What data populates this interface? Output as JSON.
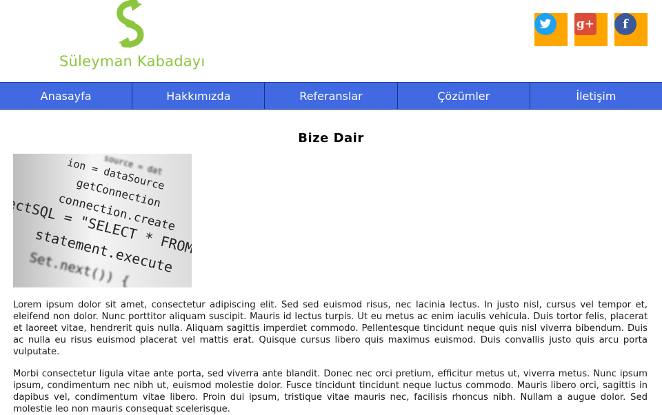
{
  "site": {
    "logo_text": "Süleyman Kabadayı",
    "logo_color": "#8cc63f"
  },
  "social": [
    {
      "name": "twitter",
      "icon": "twitter-icon",
      "color": "#1da1f2"
    },
    {
      "name": "googleplus",
      "icon": "google-plus-icon",
      "color": "#dd4b39"
    },
    {
      "name": "facebook",
      "icon": "facebook-icon",
      "color": "#3b5998"
    }
  ],
  "nav": {
    "items": [
      {
        "label": "Anasayfa"
      },
      {
        "label": "Hakkımızda"
      },
      {
        "label": "Referanslar"
      },
      {
        "label": "Çözümler"
      },
      {
        "label": "İletişim"
      }
    ],
    "bg_color": "#4169e1"
  },
  "main": {
    "title": "Bize Dair",
    "image_lines": [
      "source = dat",
      "ion = dataSource",
      "getConnection",
      "connection.create",
      "ectSQL = \"SELECT * FROM",
      "statement.execute",
      "Set.next()) {"
    ],
    "paragraphs": [
      "Lorem ipsum dolor sit amet, consectetur adipiscing elit. Sed sed euismod risus, nec lacinia lectus. In justo nisl, cursus vel tempor et, eleifend non dolor. Nunc porttitor aliquam suscipit. Mauris id lectus turpis. Ut eu metus ac enim iaculis vehicula. Duis tortor felis, placerat et laoreet vitae, hendrerit quis nulla. Aliquam sagittis imperdiet commodo. Pellentesque tincidunt neque quis nisl viverra bibendum. Duis ac nulla eu risus euismod placerat vel mattis erat. Quisque cursus libero quis maximus euismod. Duis convallis justo quis arcu porta vulputate.",
      "Morbi consectetur ligula vitae ante porta, sed viverra ante blandit. Donec nec orci pretium, efficitur metus ut, viverra metus. Nunc ipsum ipsum, condimentum nec nibh ut, euismod molestie dolor. Fusce tincidunt tincidunt neque luctus commodo. Mauris libero orci, sagittis in dapibus vel, condimentum vitae libero. Proin dui ipsum, tristique vitae mauris nec, facilisis rhoncus nibh. Nullam a augue dolor. Sed molestie leo non mauris consequat scelerisque."
    ]
  }
}
